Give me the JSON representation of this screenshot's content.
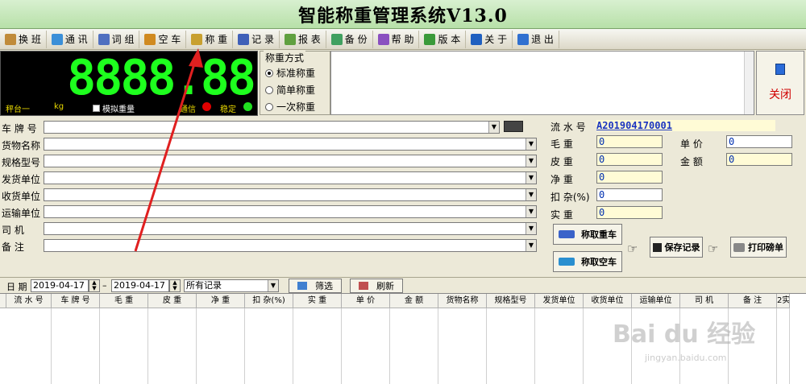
{
  "window": {
    "title": "智能称重管理系统V13.0"
  },
  "toolbar": [
    {
      "label": "换 班",
      "icon": "handshake-icon",
      "color": "#c08b3a"
    },
    {
      "label": "通 讯",
      "icon": "phone-icon",
      "color": "#3b8fd8"
    },
    {
      "label": "词 组",
      "icon": "pen-icon",
      "color": "#5070c0"
    },
    {
      "label": "空 车",
      "icon": "truck-icon",
      "color": "#d08a20"
    },
    {
      "label": "称 重",
      "icon": "scale-icon",
      "color": "#c8a030"
    },
    {
      "label": "记 录",
      "icon": "grid-icon",
      "color": "#4060b8"
    },
    {
      "label": "报 表",
      "icon": "report-icon",
      "color": "#60a040"
    },
    {
      "label": "备 份",
      "icon": "backup-icon",
      "color": "#40a060"
    },
    {
      "label": "帮 助",
      "icon": "help-icon",
      "color": "#8a50c0"
    },
    {
      "label": "版 本",
      "icon": "version-icon",
      "color": "#3a9a3a"
    },
    {
      "label": "关 于",
      "icon": "info-icon",
      "color": "#2060c0"
    },
    {
      "label": "退 出",
      "icon": "exit-icon",
      "color": "#3070d0"
    }
  ],
  "display": {
    "reading": "8888.88",
    "scale_name": "秤台一",
    "unit": "kg",
    "simulate_label": "模拟重量",
    "comm_label": "通信",
    "stable_label": "稳定"
  },
  "mode": {
    "title": "称重方式",
    "options": [
      "标准称重",
      "简单称重",
      "一次称重"
    ],
    "selected_index": 0
  },
  "close_button": {
    "label": "关闭"
  },
  "form": {
    "fields": [
      {
        "label": "车 牌 号",
        "value": ""
      },
      {
        "label": "货物名称",
        "value": ""
      },
      {
        "label": "规格型号",
        "value": ""
      },
      {
        "label": "发货单位",
        "value": ""
      },
      {
        "label": "收货单位",
        "value": ""
      },
      {
        "label": "运输单位",
        "value": ""
      },
      {
        "label": "司 机",
        "value": ""
      },
      {
        "label": "备 注",
        "value": ""
      }
    ]
  },
  "record": {
    "serial_label": "流 水 号",
    "serial_value": "A201904170001",
    "gross_label": "毛 重",
    "gross_value": "0",
    "tare_label": "皮 重",
    "tare_value": "0",
    "net_label": "净 重",
    "net_value": "0",
    "deduct_label": "扣 杂(%)",
    "deduct_value": "0",
    "actual_label": "实 重",
    "actual_value": "0",
    "price_label": "单 价",
    "price_value": "0",
    "amount_label": "金 额",
    "amount_value": "0"
  },
  "actions": {
    "weigh_loaded": "称取重车",
    "weigh_empty": "称取空车",
    "save": "保存记录",
    "print": "打印磅单"
  },
  "filter": {
    "date_label": "日 期",
    "start_date": "2019-04-17",
    "end_date": "2019-04-17",
    "dash": "–",
    "scope": "所有记录",
    "filter_button": "筛选",
    "refresh_button": "刷新"
  },
  "grid": {
    "columns": [
      "流 水 号",
      "车 牌 号",
      "毛 重",
      "皮 重",
      "净 重",
      "扣 杂(%)",
      "实 重",
      "单 价",
      "金 额",
      "货物名称",
      "规格型号",
      "发货单位",
      "收货单位",
      "运输单位",
      "司 机",
      "备 注",
      "2实"
    ]
  },
  "watermark": {
    "brand": "Bai du 经验",
    "url": "jingyan.baidu.com"
  },
  "colors": {
    "digit_green": "#1eff1e",
    "close_red": "#d00000",
    "title_bar": "#b7e0a8",
    "serial_blue": "#1a35c0",
    "arrow_red": "#e02020"
  }
}
